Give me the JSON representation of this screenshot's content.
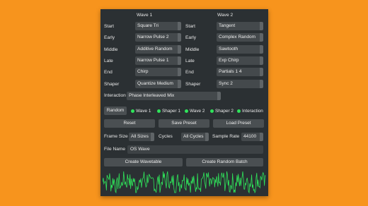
{
  "headers": {
    "wave1": "Wave 1",
    "wave2": "Wave 2"
  },
  "rows": [
    {
      "label": "Start",
      "w1": "Square Tri",
      "w2": "Tangent"
    },
    {
      "label": "Early",
      "w1": "Narrow Pulse 2",
      "w2": "Complex Random"
    },
    {
      "label": "Middle",
      "w1": "Additive Random",
      "w2": "Sawtooth"
    },
    {
      "label": "Late",
      "w1": "Narrow Pulse 1",
      "w2": "Exp Chirp"
    },
    {
      "label": "End",
      "w1": "Chirp",
      "w2": "Partials 1 4"
    },
    {
      "label": "Shaper",
      "w1": "Quantize Medium",
      "w2": "Sync 2"
    }
  ],
  "interaction": {
    "label": "Interaction",
    "value": "Phase Interleaved Mix"
  },
  "randomize": {
    "button": "Random",
    "toggles": [
      "Wave 1",
      "Shaper 1",
      "Wave 2",
      "Shaper 2",
      "Interaction"
    ]
  },
  "actions": {
    "reset": "Reset",
    "save": "Save Preset",
    "load": "Load Preset"
  },
  "frame": {
    "frame_size_label": "Frame Size",
    "frame_size_value": "All Sizes",
    "cycles_label": "Cycles",
    "cycles_value": "All Cycles",
    "sample_rate_label": "Sample Rate",
    "sample_rate_value": "44100"
  },
  "file": {
    "label": "File Name",
    "value": "OS Wave"
  },
  "create": {
    "wavetable": "Create Wavetable",
    "batch": "Create Random Batch"
  },
  "colors": {
    "background": "#F7941D",
    "panel": "#2B3033",
    "toggle_on": "#2FE35A",
    "waveform": "#2FE35A"
  }
}
